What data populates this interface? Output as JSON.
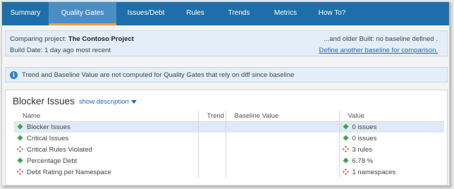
{
  "tabs": [
    {
      "label": "Summary",
      "active": false
    },
    {
      "label": "Quality Gates",
      "active": true
    },
    {
      "label": "Issues/Debt",
      "active": false
    },
    {
      "label": "Rules",
      "active": false
    },
    {
      "label": "Trends",
      "active": false
    },
    {
      "label": "Metrics",
      "active": false
    },
    {
      "label": "How To?",
      "active": false
    }
  ],
  "project": {
    "comparing_label": "Comparing project:",
    "project_name": "The Contoso Project",
    "build_date": "Build Date: 1 day ago most recent",
    "baseline_text": "...and older Built: no baseline defined .",
    "baseline_link": "Define another baseline for comparison."
  },
  "notice": {
    "text": "Trend and Baseline Value are not computed for Quality Gates that rely on diff since baseline"
  },
  "panel": {
    "title": "Blocker Issues",
    "show_description": "show description"
  },
  "table": {
    "columns": [
      "Name",
      "Trend",
      "Baseline Value",
      "Value"
    ],
    "rows": [
      {
        "name": "Blocker Issues",
        "status": "pass",
        "trend": "",
        "baseline": "",
        "value": "0 issues"
      },
      {
        "name": "Critical Issues",
        "status": "pass",
        "trend": "",
        "baseline": "",
        "value": "0 issues"
      },
      {
        "name": "Critical Rules Violated",
        "status": "fail",
        "trend": "",
        "baseline": "",
        "value": "3 rules"
      },
      {
        "name": "Percentage Debt",
        "status": "pass",
        "trend": "",
        "baseline": "",
        "value": "6.78 %"
      },
      {
        "name": "Debt Rating per Namespace",
        "status": "fail",
        "trend": "",
        "baseline": "",
        "value": "1 namespaces"
      }
    ]
  },
  "colors": {
    "tab_bar": "#1e6fa9",
    "tab_active": "#4a8fc4",
    "tab_underline": "#f0a030",
    "pass": "#3aa64a",
    "fail": "#d9302c",
    "link": "#1a6bbf"
  },
  "icons": {
    "pass": "green-diamond-icon",
    "fail": "red-fail-diamond-icon",
    "info": "info-icon",
    "caret": "caret-down-icon"
  }
}
